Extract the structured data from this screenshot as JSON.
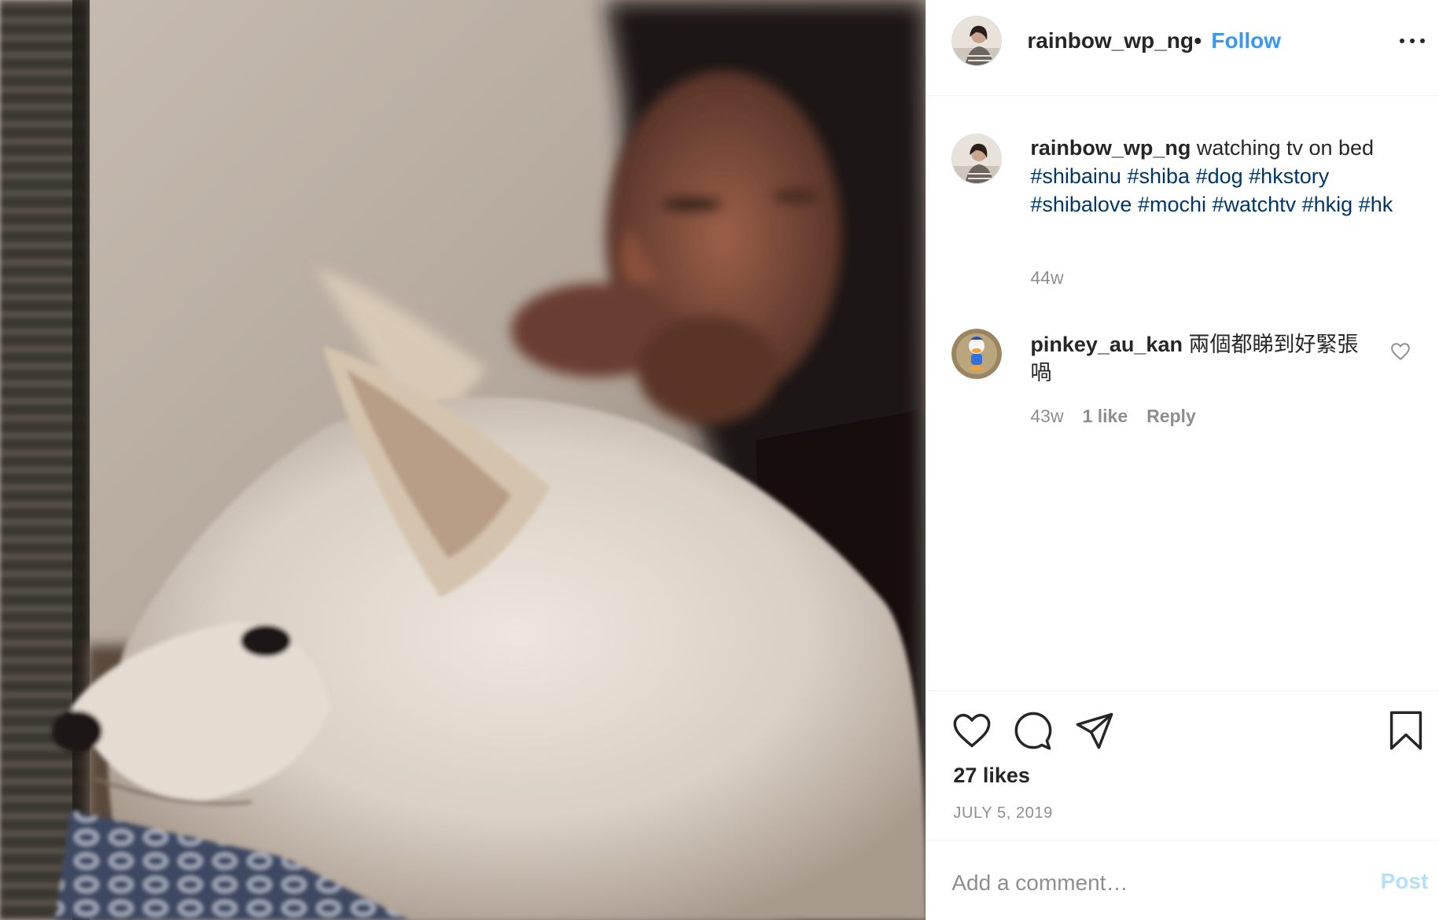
{
  "photo": {
    "description_icon": "photo-dog-and-man"
  },
  "header": {
    "username": "rainbow_wp_ng",
    "separator": "•",
    "follow_label": "Follow",
    "more_icon": "more-horizontal-icon"
  },
  "caption": {
    "username": "rainbow_wp_ng",
    "text": "watching tv on bed",
    "hashtags": [
      "#shibainu",
      "#shiba",
      "#dog",
      "#hkstory",
      "#shibalove",
      "#mochi",
      "#watchtv",
      "#hkig",
      "#hk"
    ],
    "time": "44w"
  },
  "comments": [
    {
      "username": "pinkey_au_kan",
      "text": "兩個都睇到好緊張喎",
      "time": "43w",
      "likes": "1 like",
      "reply_label": "Reply"
    }
  ],
  "actions": {
    "likes": "27 likes",
    "date": "JULY 5, 2019"
  },
  "add_comment": {
    "placeholder": "Add a comment…",
    "post_label": "Post"
  },
  "colors": {
    "link_blue": "#3897f0",
    "hashtag": "#00376b",
    "muted": "#8e8e8e",
    "post_disabled": "#b2dffc"
  }
}
